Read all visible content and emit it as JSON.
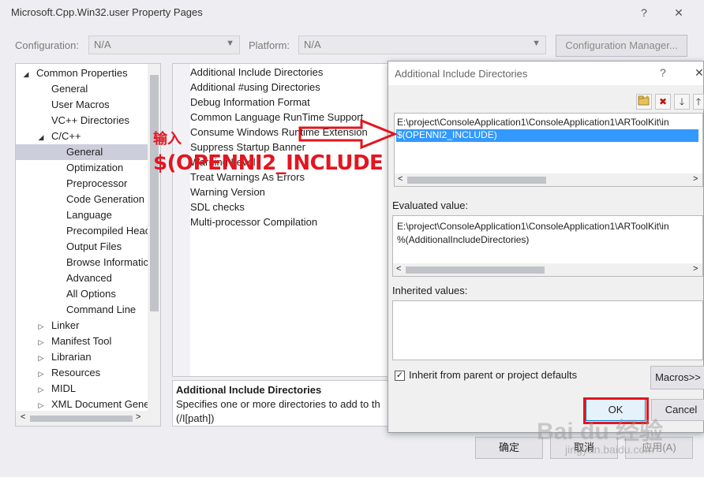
{
  "window": {
    "title": "Microsoft.Cpp.Win32.user Property Pages",
    "help": "?",
    "close": "✕"
  },
  "toolbar": {
    "config_label": "Configuration:",
    "config_value": "N/A",
    "platform_label": "Platform:",
    "platform_value": "N/A",
    "config_manager": "Configuration Manager..."
  },
  "tree": [
    {
      "label": "Common Properties",
      "indent": 0,
      "expander": "◢",
      "selected": false
    },
    {
      "label": "General",
      "indent": 1,
      "expander": "",
      "selected": false
    },
    {
      "label": "User Macros",
      "indent": 1,
      "expander": "",
      "selected": false
    },
    {
      "label": "VC++ Directories",
      "indent": 1,
      "expander": "",
      "selected": false
    },
    {
      "label": "C/C++",
      "indent": 1,
      "expander": "◢",
      "selected": false
    },
    {
      "label": "General",
      "indent": 2,
      "expander": "",
      "selected": true
    },
    {
      "label": "Optimization",
      "indent": 2,
      "expander": "",
      "selected": false
    },
    {
      "label": "Preprocessor",
      "indent": 2,
      "expander": "",
      "selected": false
    },
    {
      "label": "Code Generation",
      "indent": 2,
      "expander": "",
      "selected": false
    },
    {
      "label": "Language",
      "indent": 2,
      "expander": "",
      "selected": false
    },
    {
      "label": "Precompiled Heac",
      "indent": 2,
      "expander": "",
      "selected": false
    },
    {
      "label": "Output Files",
      "indent": 2,
      "expander": "",
      "selected": false
    },
    {
      "label": "Browse Informatic",
      "indent": 2,
      "expander": "",
      "selected": false
    },
    {
      "label": "Advanced",
      "indent": 2,
      "expander": "",
      "selected": false
    },
    {
      "label": "All Options",
      "indent": 2,
      "expander": "",
      "selected": false
    },
    {
      "label": "Command Line",
      "indent": 2,
      "expander": "",
      "selected": false
    },
    {
      "label": "Linker",
      "indent": 1,
      "expander": "▷",
      "selected": false
    },
    {
      "label": "Manifest Tool",
      "indent": 1,
      "expander": "▷",
      "selected": false
    },
    {
      "label": "Librarian",
      "indent": 1,
      "expander": "▷",
      "selected": false
    },
    {
      "label": "Resources",
      "indent": 1,
      "expander": "▷",
      "selected": false
    },
    {
      "label": "MIDL",
      "indent": 1,
      "expander": "▷",
      "selected": false
    },
    {
      "label": "XML Document Gene",
      "indent": 1,
      "expander": "▷",
      "selected": false
    }
  ],
  "properties": [
    "Additional Include Directories",
    "Additional #using Directories",
    "Debug Information Format",
    "Common Language RunTime Support",
    "Consume Windows Runtime Extension",
    "Suppress Startup Banner",
    "Warning Level",
    "Treat Warnings As Errors",
    "Warning Version",
    "SDL checks",
    "Multi-processor Compilation"
  ],
  "description": {
    "title": "Additional Include Directories",
    "text": "Specifies one or more directories to add to th",
    "switch": "(/I[path])"
  },
  "bottom_buttons": {
    "ok": "确定",
    "cancel": "取消",
    "apply": "应用(A)"
  },
  "dialog": {
    "title": "Additional Include Directories",
    "help": "?",
    "close": "✕",
    "lines": [
      "E:\\project\\ConsoleApplication1\\ConsoleApplication1\\ARToolKit\\in",
      "$(OPENNI2_INCLUDE)"
    ],
    "evaluated_label": "Evaluated value:",
    "evaluated_lines": [
      "E:\\project\\ConsoleApplication1\\ConsoleApplication1\\ARToolKit\\in",
      "%(AdditionalIncludeDirectories)"
    ],
    "inherited_label": "Inherited values:",
    "inherit_checkbox": "Inherit from parent or project defaults",
    "macros": "Macros>>",
    "ok": "OK",
    "cancel": "Cancel"
  },
  "annotation": {
    "line1": "输入",
    "line2": "$(OPENNI2_INCLUDE"
  },
  "watermark": {
    "brand": "Bai du 经验",
    "url": "jingyan.baidu.com"
  },
  "colors": {
    "annotation_red": "#e3151e",
    "selection_blue": "#3399ff",
    "tree_selection": "#cccedb"
  }
}
